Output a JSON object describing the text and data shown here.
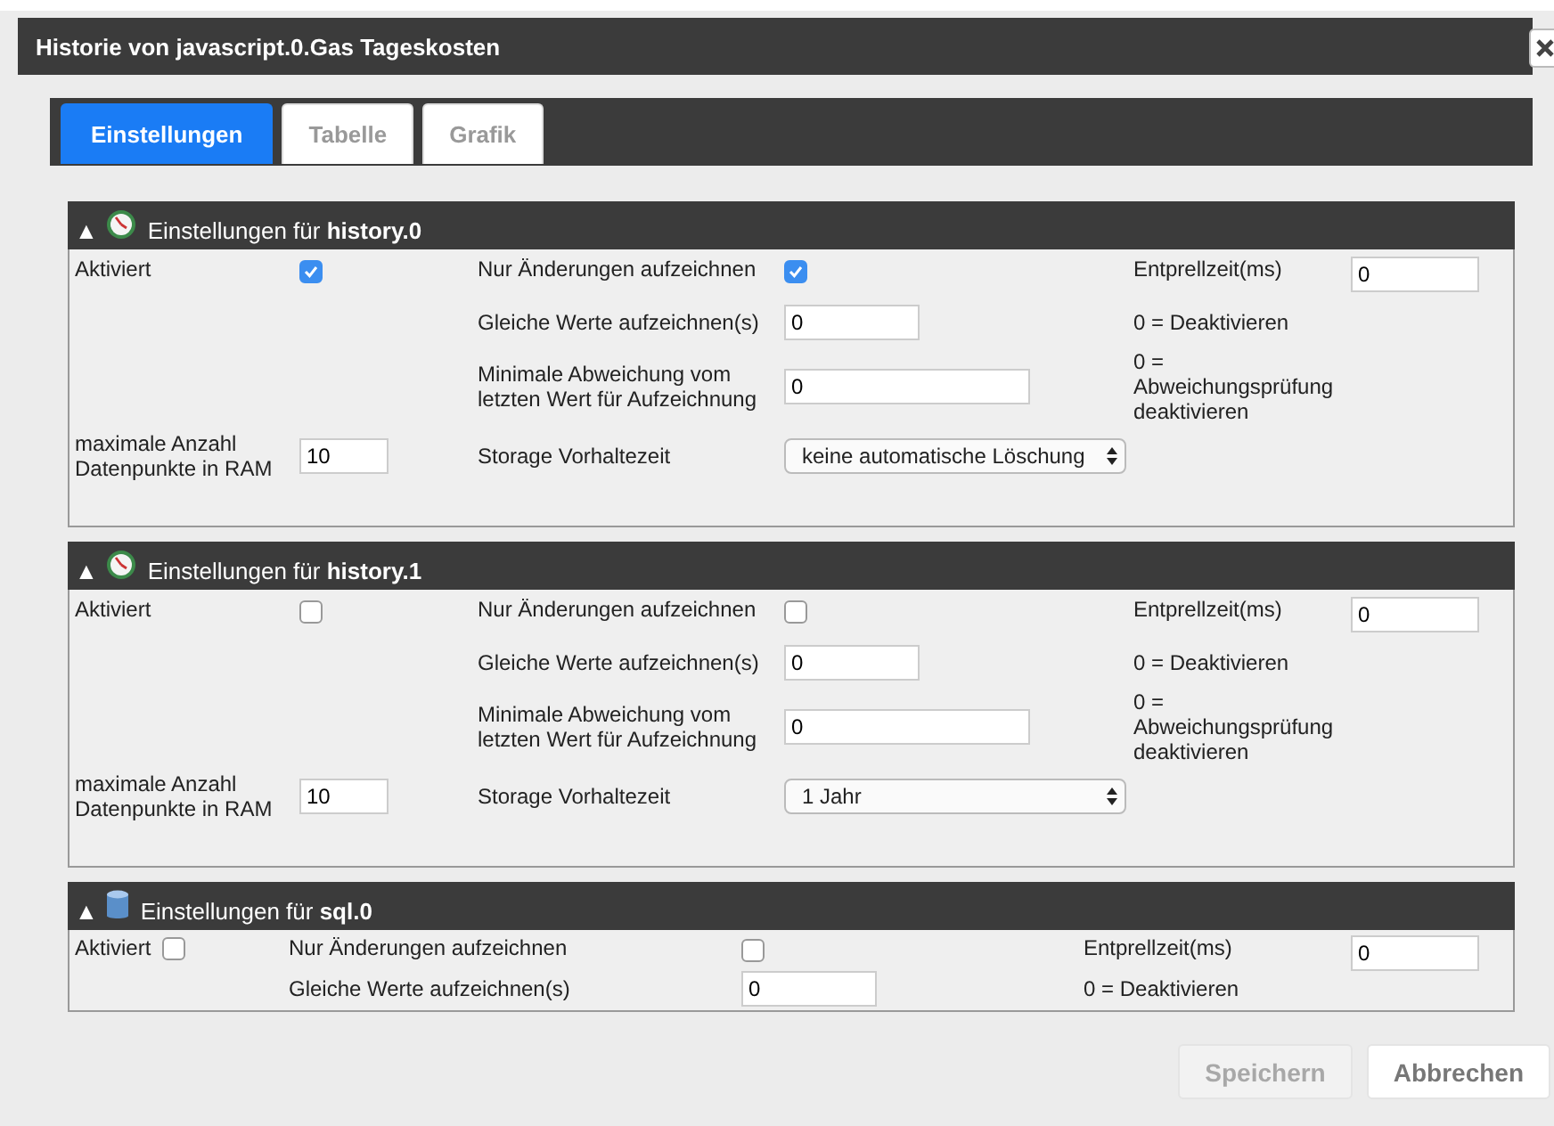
{
  "window": {
    "title": "Historie von javascript.0.Gas Tageskosten"
  },
  "tabs": [
    {
      "label": "Einstellungen",
      "selected": true
    },
    {
      "label": "Tabelle",
      "selected": false
    },
    {
      "label": "Grafik",
      "selected": false
    }
  ],
  "sections": [
    {
      "kind": "history",
      "toggle": "▲",
      "expanded": true,
      "title": "Einstellungen für **history.0**",
      "activated_label": "Aktiviert",
      "activated": true,
      "only_changes_label": "Nur Änderungen aufzeichnen",
      "only_changes": true,
      "same_values_label": "Gleiche Werte aufzeichnen(s)",
      "same_values": "0",
      "min_deviation_label": "Minimale Abweichung vom letzten Wert für Aufzeichnung",
      "min_deviation": "0",
      "debounce_label": "Entprellzeit(ms)",
      "debounce": "0",
      "debounce_hint": "0 = Deaktivieren",
      "deviation_hint": "0 = Abweichungsprüfung deaktivieren",
      "max_points_label": "maximale Anzahl Datenpunkte in RAM",
      "max_points": "10",
      "storage_label": "Storage Vorhaltezeit",
      "storage": "keine automatische Löschung"
    },
    {
      "kind": "history",
      "toggle": "▲",
      "expanded": true,
      "title": "Einstellungen für **history.1**",
      "activated_label": "Aktiviert",
      "activated": false,
      "only_changes_label": "Nur Änderungen aufzeichnen",
      "only_changes": false,
      "same_values_label": "Gleiche Werte aufzeichnen(s)",
      "same_values": "0",
      "min_deviation_label": "Minimale Abweichung vom letzten Wert für Aufzeichnung",
      "min_deviation": "0",
      "debounce_label": "Entprellzeit(ms)",
      "debounce": "0",
      "debounce_hint": "0 = Deaktivieren",
      "deviation_hint": "0 = Abweichungsprüfung deaktivieren",
      "max_points_label": "maximale Anzahl Datenpunkte in RAM",
      "max_points": "10",
      "storage_label": "Storage Vorhaltezeit",
      "storage": "1 Jahr"
    },
    {
      "kind": "sql",
      "toggle": "▲",
      "expanded": true,
      "title": "Einstellungen für **sql.0**",
      "activated_label": "Aktiviert",
      "activated": false,
      "only_changes_label": "Nur Änderungen aufzeichnen",
      "only_changes": false,
      "same_values_label": "Gleiche Werte aufzeichnen(s)",
      "same_values": "0",
      "debounce_label": "Entprellzeit(ms)",
      "debounce": "0",
      "debounce_hint": "0 = Deaktivieren"
    }
  ],
  "buttons": [
    {
      "label": "Speichern",
      "disabled": true
    },
    {
      "label": "Abbrechen",
      "disabled": false
    }
  ]
}
